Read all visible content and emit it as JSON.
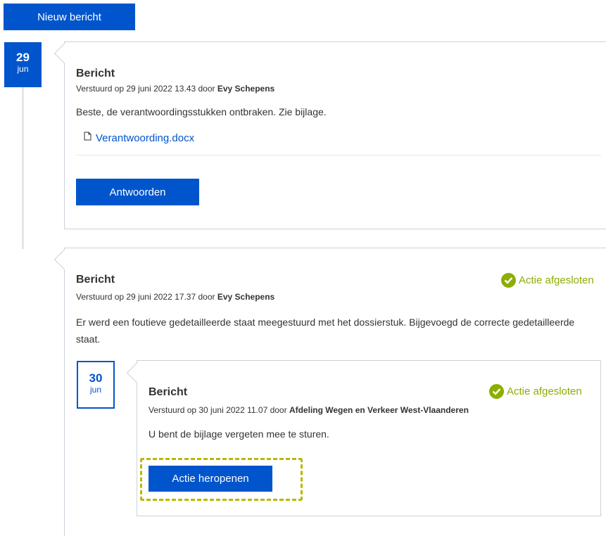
{
  "toolbar": {
    "new_message_label": "Nieuw bericht"
  },
  "messages": [
    {
      "date_day": "29",
      "date_month": "jun",
      "title": "Bericht",
      "sent_prefix": "Verstuurd op 29 juni 2022 13.43 door",
      "sender": "Evy Schepens",
      "body": "Beste, de verantwoordingsstukken ontbraken. Zie bijlage.",
      "attachment": "Verantwoording.docx",
      "action_label": "Antwoorden"
    },
    {
      "title": "Bericht",
      "status": "Actie afgesloten",
      "sent_prefix": "Verstuurd op 29 juni 2022 17.37 door",
      "sender": "Evy Schepens",
      "body": "Er werd een foutieve gedetailleerde staat meegestuurd met het dossierstuk. Bijgevoegd de correcte gedetailleerde staat.",
      "reply": {
        "date_day": "30",
        "date_month": "jun",
        "title": "Bericht",
        "status": "Actie afgesloten",
        "sent_prefix": "Verstuurd op 30 juni 2022 11.07 door",
        "sender": "Afdeling Wegen en Verkeer West-Vlaanderen",
        "body": "U bent de bijlage vergeten mee te sturen.",
        "action_label": "Actie heropenen"
      }
    }
  ],
  "colors": {
    "accent": "#0055cc",
    "status_green": "#8bae00",
    "border": "#cbd2da",
    "focus": "#b8b800"
  },
  "icons": {
    "attachment": "document-icon",
    "status": "check-circle-icon"
  }
}
